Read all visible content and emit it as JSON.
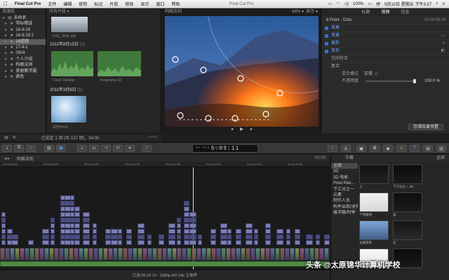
{
  "menubar": {
    "apple": "",
    "app": "Final Cut Pro",
    "items": [
      "文件",
      "编辑",
      "修剪",
      "标记",
      "片段",
      "修改",
      "显示",
      "窗口",
      "帮助"
    ],
    "center_title": "Final Cut Pro",
    "right_icons": [
      "airplay-icon",
      "wifi-icon",
      "volume-icon",
      "battery-icon"
    ],
    "battery": "100%",
    "ime": "拼",
    "datetime": "5月10日 星期五 下午3:27"
  },
  "library": {
    "header": "资源库",
    "items": [
      {
        "label": "未命名",
        "selected": false,
        "indent": 0
      },
      {
        "label": "带标精选",
        "selected": false,
        "indent": 1
      },
      {
        "label": "16-8-28",
        "selected": false,
        "indent": 1
      },
      {
        "label": "16-8-28 2",
        "selected": false,
        "indent": 1
      },
      {
        "label": "16狐精",
        "selected": true,
        "indent": 1
      },
      {
        "label": "17-4-1",
        "selected": false,
        "indent": 1
      },
      {
        "label": "0504",
        "selected": false,
        "indent": 1
      },
      {
        "label": "个人介绍",
        "selected": false,
        "indent": 1
      },
      {
        "label": "构图法则",
        "selected": false,
        "indent": 1
      },
      {
        "label": "美丽教学服",
        "selected": false,
        "indent": 1
      },
      {
        "label": "黄色",
        "selected": false,
        "indent": 1
      }
    ]
  },
  "browser": {
    "header": "所有片段",
    "events": [
      {
        "date": "2011年8月15日",
        "count": "(2)"
      },
      {
        "date": "2011年3月6日",
        "count": "(1)"
      }
    ],
    "clips": [
      {
        "caption": "Clock Outdoor"
      },
      {
        "caption": "Heaphone 10"
      },
      {
        "caption": "白色Hmm"
      }
    ],
    "top_caption": "DSC_3011 s@",
    "footer_selected": "已选定 1 项 (共 137 项)，04:00",
    "zoom_icon": "zoom-slider-icon"
  },
  "viewer": {
    "title": "构图法则",
    "zoom": "64%",
    "view_label": "显示",
    "controls": [
      "play-back-icon",
      "play-icon",
      "play-forward-icon"
    ]
  },
  "inspector": {
    "tabs": [
      "标题",
      "视频",
      "信息"
    ],
    "title": "8 Point - Dots",
    "timecode": "00:00:05:00",
    "sections": [
      {
        "label": "效果",
        "icon": "effects-icon"
      },
      {
        "label": "变换",
        "icon": "transform-icon"
      },
      {
        "label": "裁剪",
        "icon": "crop-icon"
      },
      {
        "label": "变形",
        "icon": "distort-icon"
      }
    ],
    "spatial": "空间符合",
    "composite": "复合",
    "blend_label": "混合模式",
    "blend_value": "正常",
    "opacity_label": "不透明度",
    "opacity_value": "100.0 %",
    "opacity_fraction": 1.0,
    "save_button": "存储效果预置"
  },
  "toolbar": {
    "timecode": "5:03:11",
    "timecode_label": "HR MIN SEC FR",
    "accent": "#5fa0ff"
  },
  "timeline": {
    "project": "构图法则",
    "timecode_end": "00:00",
    "ruler": [
      "00:00:00:00",
      "00:00:05:00",
      "00:00:10:00",
      "00:00:15:00",
      "00:00:20:00",
      "00:00:25:00",
      "00:00:30:00",
      "00:00:35:00"
    ],
    "status": "已选 05:03:10 - 1080p HD 24p 立体声"
  },
  "generators": {
    "header": "字幕",
    "all_label": "全部",
    "categories": [
      "全部",
      "3D",
      "3D 电影",
      "Pixel Pee...",
      "下三分之一",
      "元素",
      "制作人员",
      "构件出现/消失",
      "缓冲器/时钟"
    ],
    "tiles": [
      {
        "caption": "上"
      },
      {
        "caption": "下三分之一 3D"
      },
      {
        "caption": "个体曲线"
      },
      {
        "caption": "运"
      },
      {
        "caption": "主题演讲"
      },
      {
        "caption": "应"
      },
      {
        "caption": ""
      },
      {
        "caption": ""
      }
    ]
  },
  "watermark": "头条 @太原锦华计算机学校"
}
